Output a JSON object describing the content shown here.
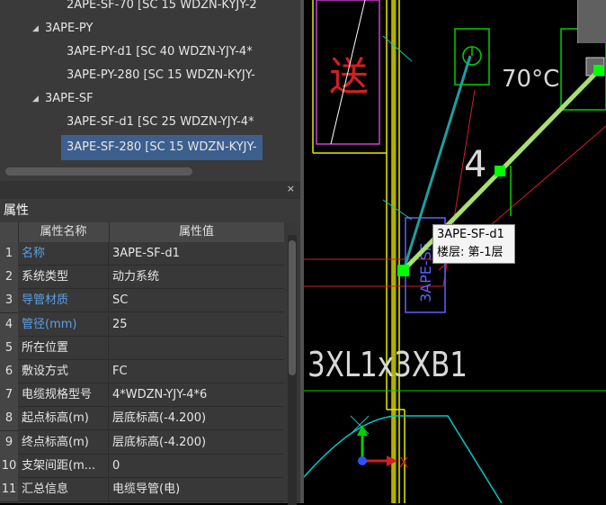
{
  "tree": {
    "items": [
      {
        "label": "2APE-SF-70 [SC 15 WDZN-KYJY-2",
        "level": 2
      },
      {
        "label": "3APE-PY",
        "level": 1,
        "expanded": true
      },
      {
        "label": "3APE-PY-d1 [SC 40 WDZN-YJY-4*",
        "level": 2
      },
      {
        "label": "3APE-PY-280 [SC 15 WDZN-KYJY-",
        "level": 2
      },
      {
        "label": "3APE-SF",
        "level": 1,
        "expanded": true
      },
      {
        "label": "3APE-SF-d1 [SC 25 WDZN-YJY-4*",
        "level": 2
      },
      {
        "label": "3APE-SF-280 [SC 15 WDZN-KYJY-",
        "level": 2,
        "selected": true
      }
    ]
  },
  "panel": {
    "close_glyph": "×",
    "title": "属性"
  },
  "props": {
    "header": {
      "name": "属性名称",
      "value": "属性值"
    },
    "rows": [
      {
        "num": "1",
        "name": "名称",
        "value": "3APE-SF-d1",
        "highlight": true
      },
      {
        "num": "2",
        "name": "系统类型",
        "value": "动力系统",
        "highlight": false
      },
      {
        "num": "3",
        "name": "导管材质",
        "value": "SC",
        "highlight": true
      },
      {
        "num": "4",
        "name": "管径(mm)",
        "value": "25",
        "highlight": true
      },
      {
        "num": "5",
        "name": "所在位置",
        "value": "",
        "highlight": false
      },
      {
        "num": "6",
        "name": "敷设方式",
        "value": "FC",
        "highlight": false
      },
      {
        "num": "7",
        "name": "电缆规格型号",
        "value": "4*WDZN-YJY-4*6",
        "highlight": false
      },
      {
        "num": "8",
        "name": "起点标高(m)",
        "value": "层底标高(-4.200)",
        "highlight": false
      },
      {
        "num": "9",
        "name": "终点标高(m)",
        "value": "层底标高(-4.200)",
        "highlight": false
      },
      {
        "num": "10",
        "name": "支架间距(m...",
        "value": "0",
        "highlight": false
      },
      {
        "num": "11",
        "name": "汇总信息",
        "value": "电缆导管(电)",
        "highlight": false
      }
    ]
  },
  "canvas": {
    "text_song": "送",
    "text_temp": "70°C",
    "text_four": "4",
    "text_3apesf": "3APE-SF",
    "text_3xl": "3XL1x3XB1",
    "axis_x": "X",
    "colors": {
      "yellow": "#e8e800",
      "green": "#00d000",
      "lime": "#a8e070",
      "cyan": "#00c8c8",
      "red": "#d02020",
      "magenta": "#d040d0",
      "blue": "#3050ff"
    }
  },
  "tooltip": {
    "line1": "3APE-SF-d1",
    "line2": "楼层: 第-1层"
  }
}
